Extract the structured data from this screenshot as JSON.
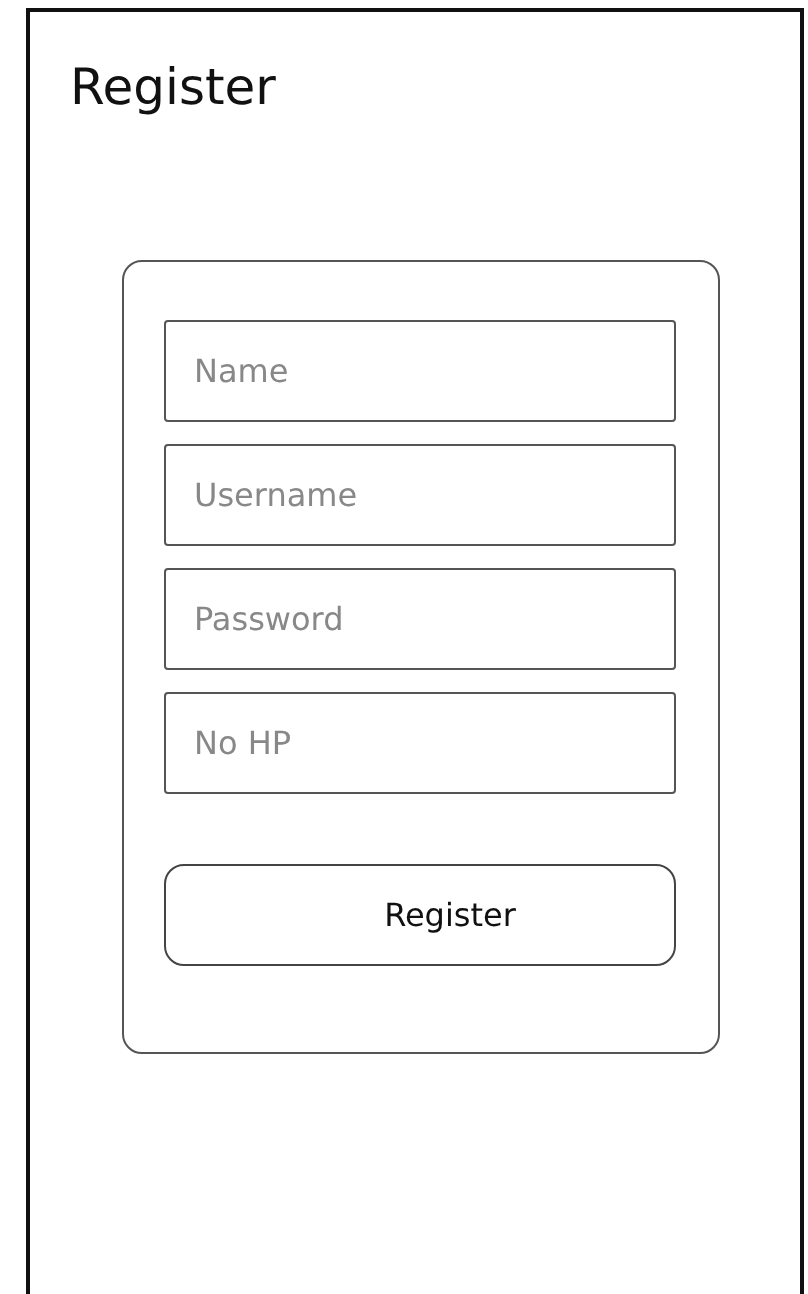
{
  "title": "Register",
  "fields": [
    {
      "placeholder": "Name"
    },
    {
      "placeholder": "Username"
    },
    {
      "placeholder": "Password"
    },
    {
      "placeholder": "No HP"
    }
  ],
  "button": "Register"
}
